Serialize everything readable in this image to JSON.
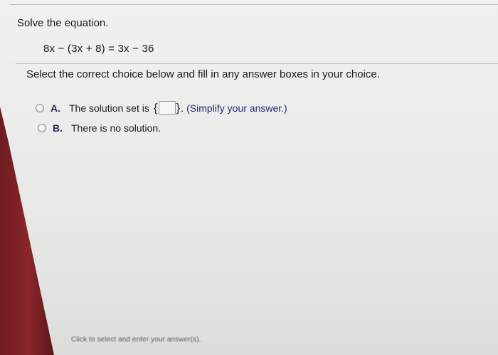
{
  "question": {
    "prompt": "Solve the equation.",
    "equation": "8x − (3x + 8) = 3x − 36",
    "instruction": "Select the correct choice below and fill in any answer boxes in your choice."
  },
  "choices": [
    {
      "letter": "A.",
      "text_before": "The solution set is",
      "brace_open": "{",
      "brace_close": "}",
      "after_box": ".",
      "hint": "(Simplify your answer.)",
      "answer_value": ""
    },
    {
      "letter": "B.",
      "text": "There is no solution."
    }
  ],
  "footer": {
    "hint": "Click to select and enter your answer(s)."
  },
  "colors": {
    "frame": "#7a1f24",
    "hint_text": "#1f2a7a",
    "choice_letter": "#2b2b57"
  }
}
